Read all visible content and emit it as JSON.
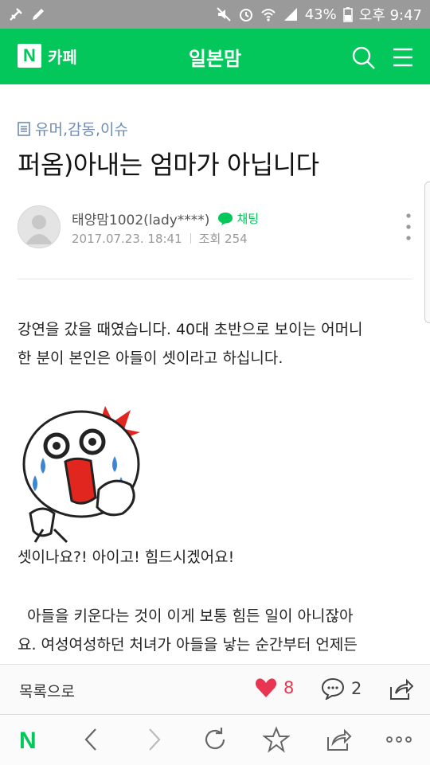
{
  "status_bar": {
    "battery": "43%",
    "time": "오후 9:47",
    "icons": [
      "usb-icon",
      "edit-icon",
      "mute-icon",
      "alarm-icon",
      "wifi-icon",
      "signal-icon",
      "battery-icon"
    ]
  },
  "app_bar": {
    "logo_letter": "N",
    "logo_text": "카페",
    "title": "일본맘",
    "icons": [
      "search-icon",
      "menu-icon"
    ]
  },
  "post": {
    "category": "유머,감동,이슈",
    "title": "퍼옴)아내는 엄마가 아닙니다",
    "author": "태양맘1002(lady****)",
    "chat_label": "채팅",
    "date": "2017.07.23. 18:41",
    "views": "조회 254",
    "body": {
      "para1_line1": "강연을 갔을 때였습니다. 40대 초반으로 보이는 어머니",
      "para1_line2": "한 분이 본인은 아들이 셋이라고 하십니다.",
      "para2": "셋이나요?! 아이고! 힘드시겠어요!",
      "para3_line1": "  아들을 키운다는 것이 이게 보통 힘든 일이 아니잖아",
      "para3_line2": "요. 여성여성하던 처녀가 아들을 낳는 순간부터 언제든"
    }
  },
  "bottom_bar": {
    "list_label": "목록으로",
    "like_count": "8",
    "comment_count": "2"
  },
  "colors": {
    "brand": "#03c75a",
    "status_bar": "#9a9a9a",
    "category": "#6e8cb3",
    "like": "#e93552"
  }
}
